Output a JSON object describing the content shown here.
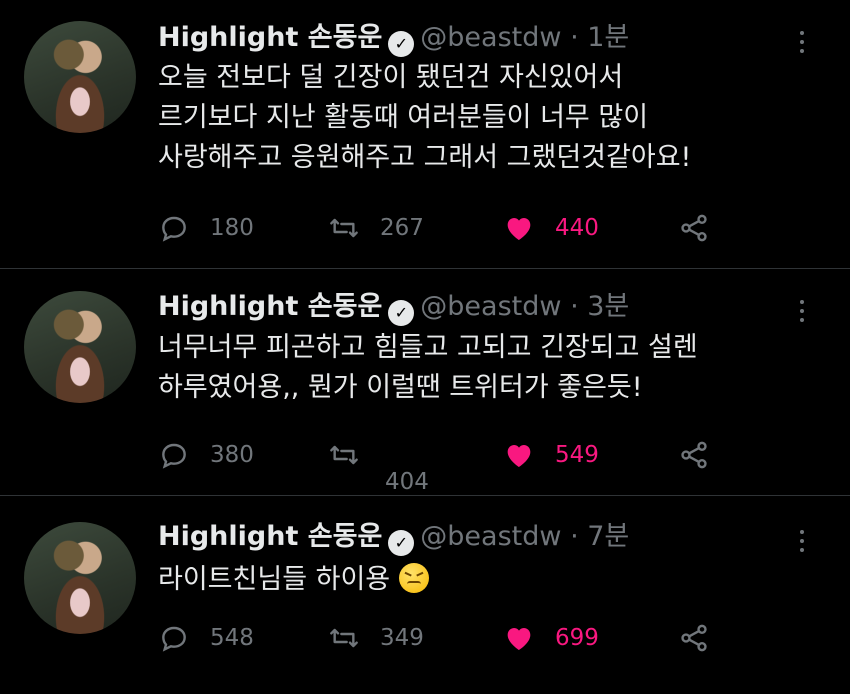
{
  "tweets": [
    {
      "name": "Highlight 손동운",
      "handle": "@beastdw",
      "sep": "·",
      "time": "1분",
      "lines": [
        "오늘 전보다 덜 긴장이 됐던건 자신있어서",
        "르기보다 지난 활동때 여러분들이 너무 많이",
        "사랑해주고 응원해주고 그래서 그랬던것같아요!"
      ],
      "replies": "180",
      "retweets": "267",
      "likes": "440"
    },
    {
      "name": "Highlight 손동운",
      "handle": "@beastdw",
      "sep": "·",
      "time": "3분",
      "lines": [
        "너무너무 피곤하고 힘들고 고되고 긴장되고 설렌",
        "하루였어용,, 뭔가 이럴땐 트위터가 좋은듯!"
      ],
      "replies": "380",
      "retweets": "404",
      "likes": "549"
    },
    {
      "name": "Highlight 손동운",
      "handle": "@beastdw",
      "sep": "·",
      "time": "7분",
      "lines": [
        "라이트친님들 하이용"
      ],
      "emoji": "confounded-face-emoji",
      "replies": "548",
      "retweets": "349",
      "likes": "699"
    }
  ],
  "colors": {
    "background": "#000000",
    "text": "#e7e9ea",
    "muted": "#71767b",
    "like": "#f91880",
    "divider": "#2f3336"
  },
  "icons": {
    "reply": "reply-icon",
    "retweet": "retweet-icon",
    "like": "heart-icon",
    "share": "share-icon",
    "more": "more-icon",
    "verified": "verified-badge-icon"
  }
}
